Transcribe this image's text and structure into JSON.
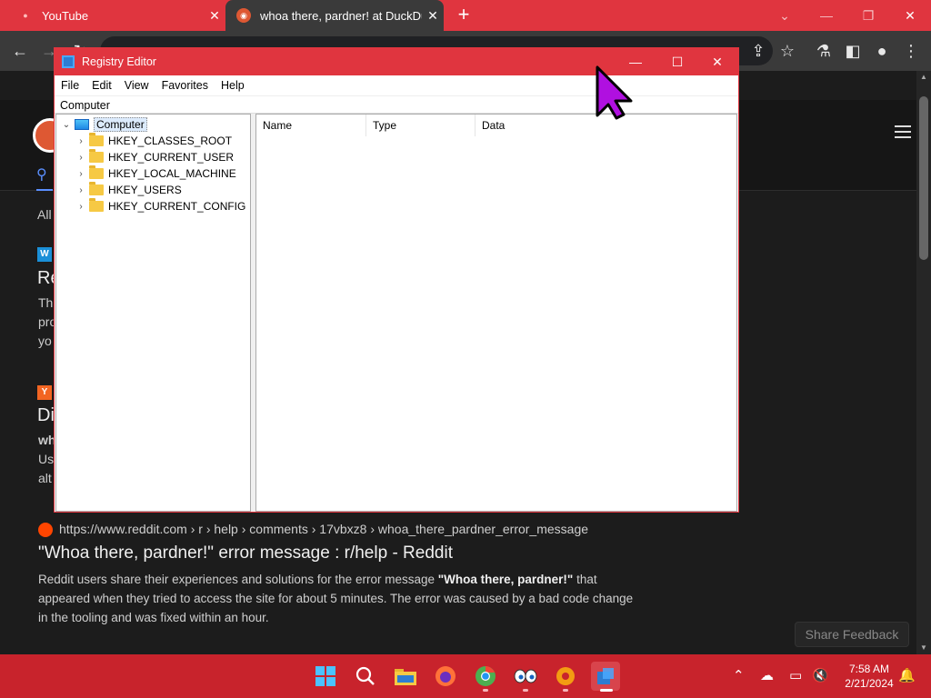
{
  "browser": {
    "tabs": [
      {
        "title": "YouTube"
      },
      {
        "title": "whoa there, pardner! at DuckDu"
      }
    ],
    "new_tab": "+",
    "close_glyph": "✕"
  },
  "page": {
    "filter_all": "All",
    "snippet1_badge": "W",
    "snippet1_head": "Re",
    "snippet1_lines": [
      "Th",
      "pro",
      "yo"
    ],
    "snippet2_badge": "Y",
    "snippet2_head": "Di",
    "snippet2_lines": [
      "wh",
      "Us",
      "alt"
    ],
    "result": {
      "url": "https://www.reddit.com › r › help › comments › 17vbxz8 › whoa_there_pardner_error_message",
      "title": "\"Whoa there, pardner!\" error message : r/help - Reddit",
      "desc_before": "Reddit users share their experiences and solutions for the error message ",
      "desc_bold": "\"Whoa there, pardner!\"",
      "desc_after": " that appeared when they tried to access the site for about 5 minutes. The error was caused by a bad code change in the tooling and was fixed within an hour."
    },
    "share_feedback": "Share Feedback"
  },
  "regedit": {
    "title": "Registry Editor",
    "menu": [
      "File",
      "Edit",
      "View",
      "Favorites",
      "Help"
    ],
    "address": "Computer",
    "tree_root": "Computer",
    "hives": [
      "HKEY_CLASSES_ROOT",
      "HKEY_CURRENT_USER",
      "HKEY_LOCAL_MACHINE",
      "HKEY_USERS",
      "HKEY_CURRENT_CONFIG"
    ],
    "columns": [
      "Name",
      "Type",
      "Data"
    ]
  },
  "taskbar": {
    "time": "7:58 AM",
    "date": "2/21/2024"
  },
  "colors": {
    "accent": "#e0353f",
    "taskbar": "#c8232c",
    "cursor": "#b010e0"
  }
}
